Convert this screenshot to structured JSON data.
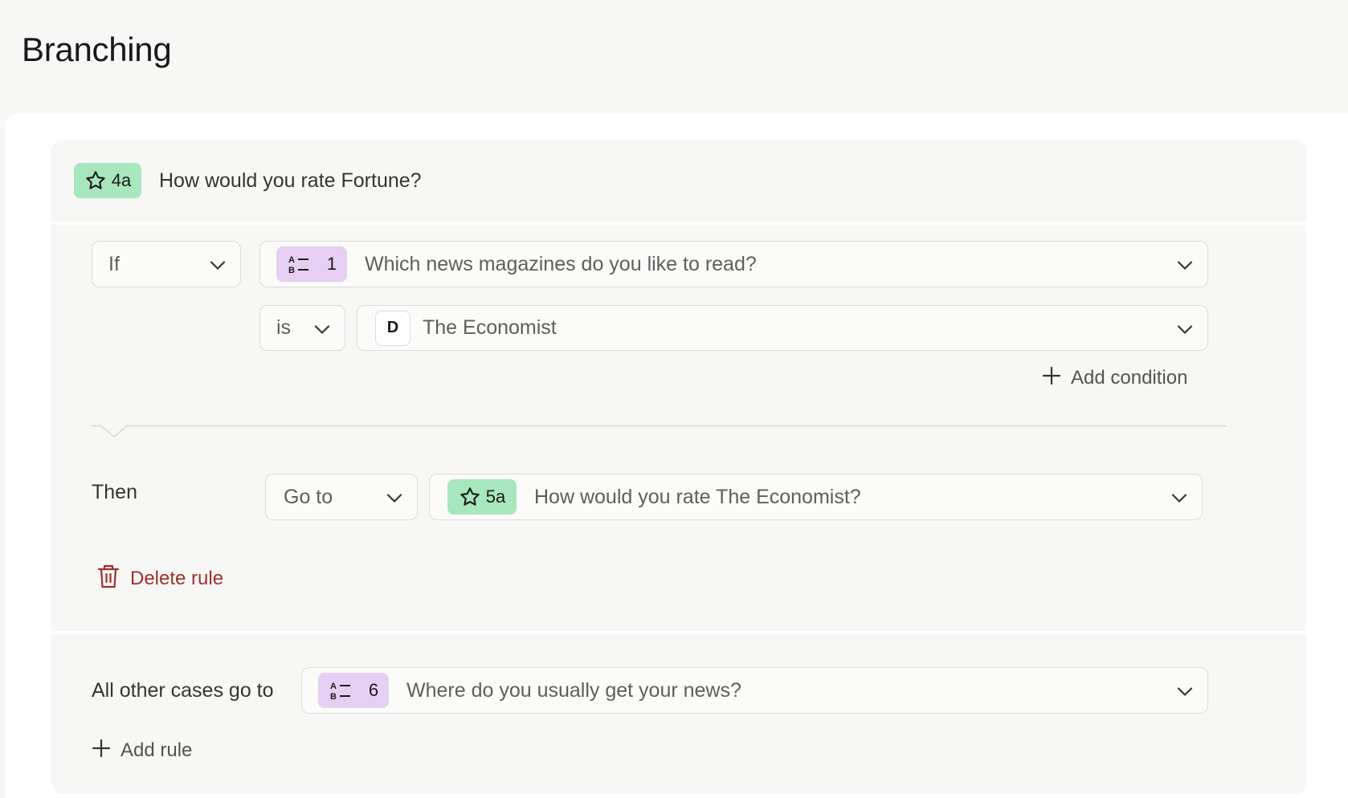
{
  "page": {
    "title": "Branching"
  },
  "source_question": {
    "badge_number": "4a",
    "text": "How would you rate Fortune?",
    "icon": "star-icon"
  },
  "rule": {
    "condition_type": "If",
    "question": {
      "badge_number": "1",
      "text": "Which news magazines do you like to read?",
      "icon": "multiple-choice-icon"
    },
    "operator": "is",
    "value": {
      "letter": "D",
      "text": "The Economist"
    },
    "add_condition_label": "Add condition",
    "then_label": "Then",
    "action": "Go to",
    "target": {
      "badge_number": "5a",
      "text": "How would you rate The Economist?",
      "icon": "star-icon"
    },
    "delete_label": "Delete rule"
  },
  "fallback": {
    "label": "All other cases go to",
    "target": {
      "badge_number": "6",
      "text": "Where do you usually get your news?",
      "icon": "multiple-choice-icon"
    }
  },
  "add_rule_label": "Add rule",
  "colors": {
    "green_badge": "#a8e6bd",
    "purple_badge": "#e5d0f3",
    "danger": "#9f2f2d"
  }
}
